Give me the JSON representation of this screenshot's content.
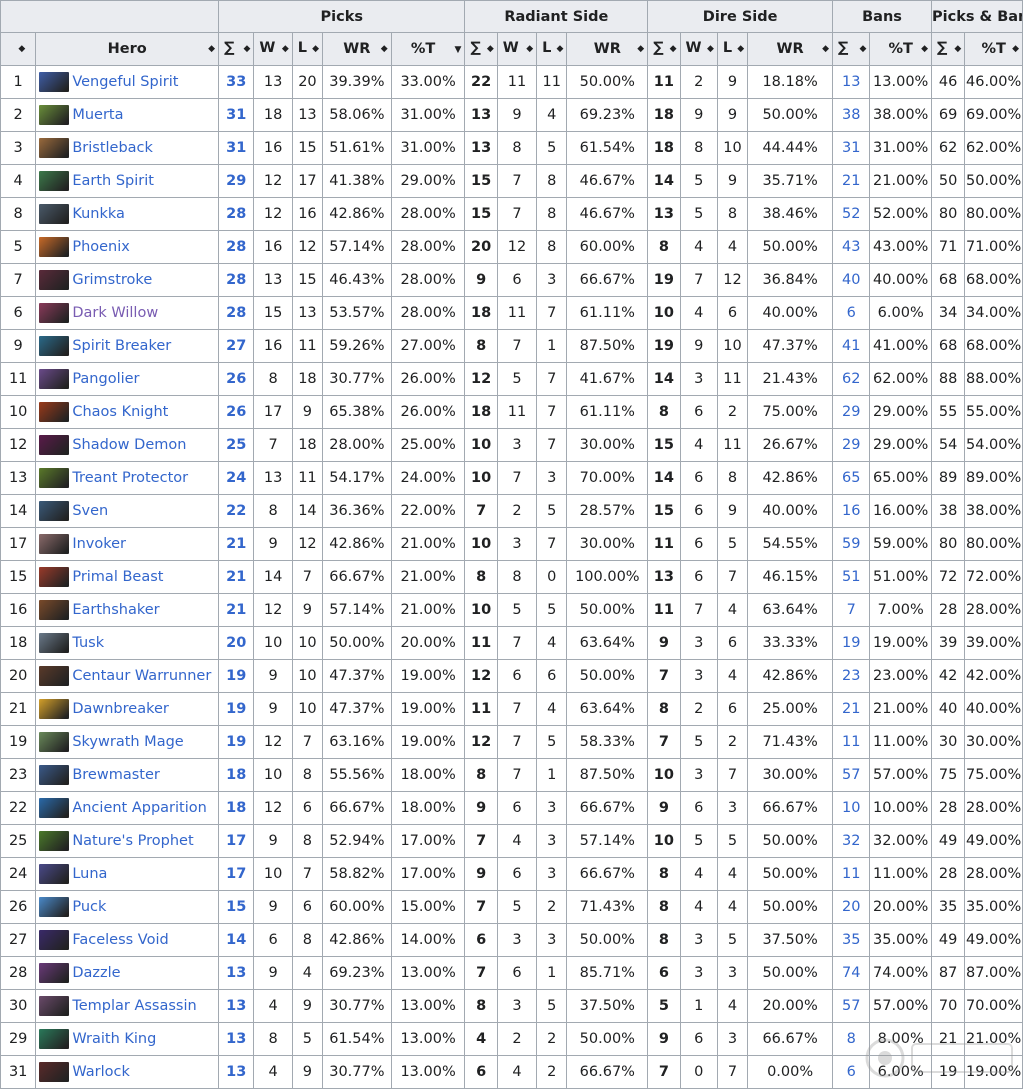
{
  "header": {
    "groups": [
      "Picks",
      "Radiant Side",
      "Dire Side",
      "Bans",
      "Picks & Bans"
    ],
    "columns": [
      "Hero",
      "∑",
      "W",
      "L",
      "WR",
      "%T",
      "∑",
      "W",
      "L",
      "WR",
      "∑",
      "W",
      "L",
      "WR",
      "∑",
      "%T",
      "∑",
      "%T"
    ]
  },
  "icons": {
    "sort": "sort-icon",
    "sort_desc": "sort-descending-icon"
  },
  "rows": [
    {
      "rank": "1",
      "hero": "Vengeful Spirit",
      "icon": "#3f5ea8",
      "pt": "33",
      "pw": "13",
      "pl": "20",
      "pwr": "39.39%",
      "pct": "33.00%",
      "rt": "22",
      "rw": "11",
      "rl": "11",
      "rwr": "50.00%",
      "dt": "11",
      "dw": "2",
      "dl": "9",
      "dwr": "18.18%",
      "bt": "13",
      "bpct": "13.00%",
      "pbt": "46",
      "pbpct": "46.00%"
    },
    {
      "rank": "2",
      "hero": "Muerta",
      "icon": "#6a8f3a",
      "pt": "31",
      "pw": "18",
      "pl": "13",
      "pwr": "58.06%",
      "pct": "31.00%",
      "rt": "13",
      "rw": "9",
      "rl": "4",
      "rwr": "69.23%",
      "dt": "18",
      "dw": "9",
      "dl": "9",
      "dwr": "50.00%",
      "bt": "38",
      "bpct": "38.00%",
      "pbt": "69",
      "pbpct": "69.00%"
    },
    {
      "rank": "3",
      "hero": "Bristleback",
      "icon": "#9a6a3c",
      "pt": "31",
      "pw": "16",
      "pl": "15",
      "pwr": "51.61%",
      "pct": "31.00%",
      "rt": "13",
      "rw": "8",
      "rl": "5",
      "rwr": "61.54%",
      "dt": "18",
      "dw": "8",
      "dl": "10",
      "dwr": "44.44%",
      "bt": "31",
      "bpct": "31.00%",
      "pbt": "62",
      "pbpct": "62.00%"
    },
    {
      "rank": "4",
      "hero": "Earth Spirit",
      "icon": "#3c7a4a",
      "pt": "29",
      "pw": "12",
      "pl": "17",
      "pwr": "41.38%",
      "pct": "29.00%",
      "rt": "15",
      "rw": "7",
      "rl": "8",
      "rwr": "46.67%",
      "dt": "14",
      "dw": "5",
      "dl": "9",
      "dwr": "35.71%",
      "bt": "21",
      "bpct": "21.00%",
      "pbt": "50",
      "pbpct": "50.00%"
    },
    {
      "rank": "8",
      "hero": "Kunkka",
      "icon": "#4a5a6a",
      "pt": "28",
      "pw": "12",
      "pl": "16",
      "pwr": "42.86%",
      "pct": "28.00%",
      "rt": "15",
      "rw": "7",
      "rl": "8",
      "rwr": "46.67%",
      "dt": "13",
      "dw": "5",
      "dl": "8",
      "dwr": "38.46%",
      "bt": "52",
      "bpct": "52.00%",
      "pbt": "80",
      "pbpct": "80.00%"
    },
    {
      "rank": "5",
      "hero": "Phoenix",
      "icon": "#c86a28",
      "pt": "28",
      "pw": "16",
      "pl": "12",
      "pwr": "57.14%",
      "pct": "28.00%",
      "rt": "20",
      "rw": "12",
      "rl": "8",
      "rwr": "60.00%",
      "dt": "8",
      "dw": "4",
      "dl": "4",
      "dwr": "50.00%",
      "bt": "43",
      "bpct": "43.00%",
      "pbt": "71",
      "pbpct": "71.00%"
    },
    {
      "rank": "7",
      "hero": "Grimstroke",
      "icon": "#5a2a3a",
      "pt": "28",
      "pw": "13",
      "pl": "15",
      "pwr": "46.43%",
      "pct": "28.00%",
      "rt": "9",
      "rw": "6",
      "rl": "3",
      "rwr": "66.67%",
      "dt": "19",
      "dw": "7",
      "dl": "12",
      "dwr": "36.84%",
      "bt": "40",
      "bpct": "40.00%",
      "pbt": "68",
      "pbpct": "68.00%"
    },
    {
      "rank": "6",
      "hero": "Dark Willow",
      "icon": "#8a3a5a",
      "pt": "28",
      "pw": "15",
      "pl": "13",
      "pwr": "53.57%",
      "pct": "28.00%",
      "rt": "18",
      "rw": "11",
      "rl": "7",
      "rwr": "61.11%",
      "dt": "10",
      "dw": "4",
      "dl": "6",
      "dwr": "40.00%",
      "bt": "6",
      "bpct": "6.00%",
      "pbt": "34",
      "pbpct": "34.00%"
    },
    {
      "rank": "9",
      "hero": "Spirit Breaker",
      "icon": "#2a6a8a",
      "pt": "27",
      "pw": "16",
      "pl": "11",
      "pwr": "59.26%",
      "pct": "27.00%",
      "rt": "8",
      "rw": "7",
      "rl": "1",
      "rwr": "87.50%",
      "dt": "19",
      "dw": "9",
      "dl": "10",
      "dwr": "47.37%",
      "bt": "41",
      "bpct": "41.00%",
      "pbt": "68",
      "pbpct": "68.00%"
    },
    {
      "rank": "11",
      "hero": "Pangolier",
      "icon": "#6a4a8a",
      "pt": "26",
      "pw": "8",
      "pl": "18",
      "pwr": "30.77%",
      "pct": "26.00%",
      "rt": "12",
      "rw": "5",
      "rl": "7",
      "rwr": "41.67%",
      "dt": "14",
      "dw": "3",
      "dl": "11",
      "dwr": "21.43%",
      "bt": "62",
      "bpct": "62.00%",
      "pbt": "88",
      "pbpct": "88.00%"
    },
    {
      "rank": "10",
      "hero": "Chaos Knight",
      "icon": "#9a3a1a",
      "pt": "26",
      "pw": "17",
      "pl": "9",
      "pwr": "65.38%",
      "pct": "26.00%",
      "rt": "18",
      "rw": "11",
      "rl": "7",
      "rwr": "61.11%",
      "dt": "8",
      "dw": "6",
      "dl": "2",
      "dwr": "75.00%",
      "bt": "29",
      "bpct": "29.00%",
      "pbt": "55",
      "pbpct": "55.00%"
    },
    {
      "rank": "12",
      "hero": "Shadow Demon",
      "icon": "#5a1a4a",
      "pt": "25",
      "pw": "7",
      "pl": "18",
      "pwr": "28.00%",
      "pct": "25.00%",
      "rt": "10",
      "rw": "3",
      "rl": "7",
      "rwr": "30.00%",
      "dt": "15",
      "dw": "4",
      "dl": "11",
      "dwr": "26.67%",
      "bt": "29",
      "bpct": "29.00%",
      "pbt": "54",
      "pbpct": "54.00%"
    },
    {
      "rank": "13",
      "hero": "Treant Protector",
      "icon": "#5a7a2a",
      "pt": "24",
      "pw": "13",
      "pl": "11",
      "pwr": "54.17%",
      "pct": "24.00%",
      "rt": "10",
      "rw": "7",
      "rl": "3",
      "rwr": "70.00%",
      "dt": "14",
      "dw": "6",
      "dl": "8",
      "dwr": "42.86%",
      "bt": "65",
      "bpct": "65.00%",
      "pbt": "89",
      "pbpct": "89.00%"
    },
    {
      "rank": "14",
      "hero": "Sven",
      "icon": "#3a5a7a",
      "pt": "22",
      "pw": "8",
      "pl": "14",
      "pwr": "36.36%",
      "pct": "22.00%",
      "rt": "7",
      "rw": "2",
      "rl": "5",
      "rwr": "28.57%",
      "dt": "15",
      "dw": "6",
      "dl": "9",
      "dwr": "40.00%",
      "bt": "16",
      "bpct": "16.00%",
      "pbt": "38",
      "pbpct": "38.00%"
    },
    {
      "rank": "17",
      "hero": "Invoker",
      "icon": "#8a6a6a",
      "pt": "21",
      "pw": "9",
      "pl": "12",
      "pwr": "42.86%",
      "pct": "21.00%",
      "rt": "10",
      "rw": "3",
      "rl": "7",
      "rwr": "30.00%",
      "dt": "11",
      "dw": "6",
      "dl": "5",
      "dwr": "54.55%",
      "bt": "59",
      "bpct": "59.00%",
      "pbt": "80",
      "pbpct": "80.00%"
    },
    {
      "rank": "15",
      "hero": "Primal Beast",
      "icon": "#9a3a2a",
      "pt": "21",
      "pw": "14",
      "pl": "7",
      "pwr": "66.67%",
      "pct": "21.00%",
      "rt": "8",
      "rw": "8",
      "rl": "0",
      "rwr": "100.00%",
      "dt": "13",
      "dw": "6",
      "dl": "7",
      "dwr": "46.15%",
      "bt": "51",
      "bpct": "51.00%",
      "pbt": "72",
      "pbpct": "72.00%"
    },
    {
      "rank": "16",
      "hero": "Earthshaker",
      "icon": "#7a4a2a",
      "pt": "21",
      "pw": "12",
      "pl": "9",
      "pwr": "57.14%",
      "pct": "21.00%",
      "rt": "10",
      "rw": "5",
      "rl": "5",
      "rwr": "50.00%",
      "dt": "11",
      "dw": "7",
      "dl": "4",
      "dwr": "63.64%",
      "bt": "7",
      "bpct": "7.00%",
      "pbt": "28",
      "pbpct": "28.00%"
    },
    {
      "rank": "18",
      "hero": "Tusk",
      "icon": "#6a7a8a",
      "pt": "20",
      "pw": "10",
      "pl": "10",
      "pwr": "50.00%",
      "pct": "20.00%",
      "rt": "11",
      "rw": "7",
      "rl": "4",
      "rwr": "63.64%",
      "dt": "9",
      "dw": "3",
      "dl": "6",
      "dwr": "33.33%",
      "bt": "19",
      "bpct": "19.00%",
      "pbt": "39",
      "pbpct": "39.00%"
    },
    {
      "rank": "20",
      "hero": "Centaur Warrunner",
      "icon": "#5a3a2a",
      "pt": "19",
      "pw": "9",
      "pl": "10",
      "pwr": "47.37%",
      "pct": "19.00%",
      "rt": "12",
      "rw": "6",
      "rl": "6",
      "rwr": "50.00%",
      "dt": "7",
      "dw": "3",
      "dl": "4",
      "dwr": "42.86%",
      "bt": "23",
      "bpct": "23.00%",
      "pbt": "42",
      "pbpct": "42.00%"
    },
    {
      "rank": "21",
      "hero": "Dawnbreaker",
      "icon": "#d4a02a",
      "pt": "19",
      "pw": "9",
      "pl": "10",
      "pwr": "47.37%",
      "pct": "19.00%",
      "rt": "11",
      "rw": "7",
      "rl": "4",
      "rwr": "63.64%",
      "dt": "8",
      "dw": "2",
      "dl": "6",
      "dwr": "25.00%",
      "bt": "21",
      "bpct": "21.00%",
      "pbt": "40",
      "pbpct": "40.00%"
    },
    {
      "rank": "19",
      "hero": "Skywrath Mage",
      "icon": "#6a8a5a",
      "pt": "19",
      "pw": "12",
      "pl": "7",
      "pwr": "63.16%",
      "pct": "19.00%",
      "rt": "12",
      "rw": "7",
      "rl": "5",
      "rwr": "58.33%",
      "dt": "7",
      "dw": "5",
      "dl": "2",
      "dwr": "71.43%",
      "bt": "11",
      "bpct": "11.00%",
      "pbt": "30",
      "pbpct": "30.00%"
    },
    {
      "rank": "23",
      "hero": "Brewmaster",
      "icon": "#3a5a8a",
      "pt": "18",
      "pw": "10",
      "pl": "8",
      "pwr": "55.56%",
      "pct": "18.00%",
      "rt": "8",
      "rw": "7",
      "rl": "1",
      "rwr": "87.50%",
      "dt": "10",
      "dw": "3",
      "dl": "7",
      "dwr": "30.00%",
      "bt": "57",
      "bpct": "57.00%",
      "pbt": "75",
      "pbpct": "75.00%"
    },
    {
      "rank": "22",
      "hero": "Ancient Apparition",
      "icon": "#2a6aaa",
      "pt": "18",
      "pw": "12",
      "pl": "6",
      "pwr": "66.67%",
      "pct": "18.00%",
      "rt": "9",
      "rw": "6",
      "rl": "3",
      "rwr": "66.67%",
      "dt": "9",
      "dw": "6",
      "dl": "3",
      "dwr": "66.67%",
      "bt": "10",
      "bpct": "10.00%",
      "pbt": "28",
      "pbpct": "28.00%"
    },
    {
      "rank": "25",
      "hero": "Nature's Prophet",
      "icon": "#4a7a2a",
      "pt": "17",
      "pw": "9",
      "pl": "8",
      "pwr": "52.94%",
      "pct": "17.00%",
      "rt": "7",
      "rw": "4",
      "rl": "3",
      "rwr": "57.14%",
      "dt": "10",
      "dw": "5",
      "dl": "5",
      "dwr": "50.00%",
      "bt": "32",
      "bpct": "32.00%",
      "pbt": "49",
      "pbpct": "49.00%"
    },
    {
      "rank": "24",
      "hero": "Luna",
      "icon": "#4a4a8a",
      "pt": "17",
      "pw": "10",
      "pl": "7",
      "pwr": "58.82%",
      "pct": "17.00%",
      "rt": "9",
      "rw": "6",
      "rl": "3",
      "rwr": "66.67%",
      "dt": "8",
      "dw": "4",
      "dl": "4",
      "dwr": "50.00%",
      "bt": "11",
      "bpct": "11.00%",
      "pbt": "28",
      "pbpct": "28.00%"
    },
    {
      "rank": "26",
      "hero": "Puck",
      "icon": "#4a8aca",
      "pt": "15",
      "pw": "9",
      "pl": "6",
      "pwr": "60.00%",
      "pct": "15.00%",
      "rt": "7",
      "rw": "5",
      "rl": "2",
      "rwr": "71.43%",
      "dt": "8",
      "dw": "4",
      "dl": "4",
      "dwr": "50.00%",
      "bt": "20",
      "bpct": "20.00%",
      "pbt": "35",
      "pbpct": "35.00%"
    },
    {
      "rank": "27",
      "hero": "Faceless Void",
      "icon": "#3a2a6a",
      "pt": "14",
      "pw": "6",
      "pl": "8",
      "pwr": "42.86%",
      "pct": "14.00%",
      "rt": "6",
      "rw": "3",
      "rl": "3",
      "rwr": "50.00%",
      "dt": "8",
      "dw": "3",
      "dl": "5",
      "dwr": "37.50%",
      "bt": "35",
      "bpct": "35.00%",
      "pbt": "49",
      "pbpct": "49.00%"
    },
    {
      "rank": "28",
      "hero": "Dazzle",
      "icon": "#6a3a7a",
      "pt": "13",
      "pw": "9",
      "pl": "4",
      "pwr": "69.23%",
      "pct": "13.00%",
      "rt": "7",
      "rw": "6",
      "rl": "1",
      "rwr": "85.71%",
      "dt": "6",
      "dw": "3",
      "dl": "3",
      "dwr": "50.00%",
      "bt": "74",
      "bpct": "74.00%",
      "pbt": "87",
      "pbpct": "87.00%"
    },
    {
      "rank": "30",
      "hero": "Templar Assassin",
      "icon": "#6a4a6a",
      "pt": "13",
      "pw": "4",
      "pl": "9",
      "pwr": "30.77%",
      "pct": "13.00%",
      "rt": "8",
      "rw": "3",
      "rl": "5",
      "rwr": "37.50%",
      "dt": "5",
      "dw": "1",
      "dl": "4",
      "dwr": "20.00%",
      "bt": "57",
      "bpct": "57.00%",
      "pbt": "70",
      "pbpct": "70.00%"
    },
    {
      "rank": "29",
      "hero": "Wraith King",
      "icon": "#2a7a5a",
      "pt": "13",
      "pw": "8",
      "pl": "5",
      "pwr": "61.54%",
      "pct": "13.00%",
      "rt": "4",
      "rw": "2",
      "rl": "2",
      "rwr": "50.00%",
      "dt": "9",
      "dw": "6",
      "dl": "3",
      "dwr": "66.67%",
      "bt": "8",
      "bpct": "8.00%",
      "pbt": "21",
      "pbpct": "21.00%"
    },
    {
      "rank": "31",
      "hero": "Warlock",
      "icon": "#5a2a2a",
      "pt": "13",
      "pw": "4",
      "pl": "9",
      "pwr": "30.77%",
      "pct": "13.00%",
      "rt": "6",
      "rw": "4",
      "rl": "2",
      "rwr": "66.67%",
      "dt": "7",
      "dw": "0",
      "dl": "7",
      "dwr": "0.00%",
      "bt": "6",
      "bpct": "6.00%",
      "pbt": "19",
      "pbpct": "19.00%"
    }
  ],
  "colors": {
    "link": "#3366cc",
    "visited": "#795cb2",
    "header_bg": "#eaecf0",
    "border": "#a2a9b1"
  }
}
